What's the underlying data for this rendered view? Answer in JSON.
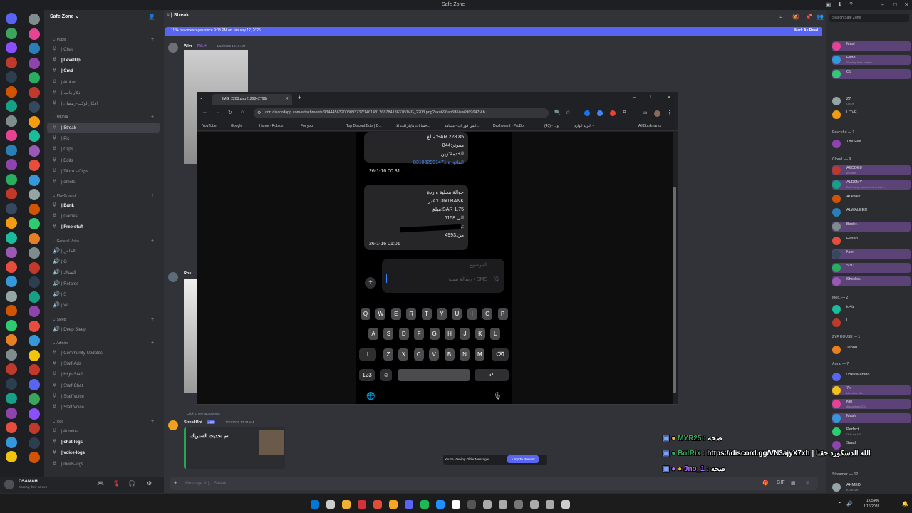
{
  "window": {
    "title": "Safe Zone"
  },
  "server": {
    "name": "Safe Zone",
    "categories": {
      "public": "Public",
      "media": "MEDIA",
      "playground": "PlayGround",
      "general_voice": "General Voice",
      "sleep": "Sleep",
      "admins": "Admins",
      "logs": "logs"
    },
    "public_channels": [
      "| Chat",
      "| LevelUp",
      "| Cmd",
      "| Athkar",
      "| اذكارجانت",
      "| افكار-لوكت-رمضان"
    ],
    "media_channels": [
      "| Streak",
      "| Pic",
      "| Clips",
      "| Edits",
      "| Tiktok - Clips",
      "| emots"
    ],
    "playground_channels": [
      "| Bank",
      "| Games",
      "| Free-stuff"
    ],
    "voice_channels": [
      "| الخاص",
      "| G",
      "| الستاك",
      "| Retards",
      "| S",
      "| W"
    ],
    "sleep_channels": [
      "| Deep Sleep"
    ],
    "admin_channels": [
      "| Community-Updates",
      "| Staff-Ads",
      "| High-Staff",
      "| Staff-Chat",
      "| Staff Voice",
      "| Staff Voice"
    ],
    "log_channels": [
      "| Admins",
      "| chat-logs",
      "| voice-logs",
      "| mods-logs"
    ]
  },
  "user": {
    "name": "OSAMAH",
    "status": "Sharing their screen"
  },
  "chat": {
    "channel": "| Streak",
    "new_messages_banner": "113+ new messages since 9:03 PM on January 12, 2026",
    "mark_as_read": "Mark As Read",
    "msg1_author": "Wlvr",
    "msg1_tag": "JWLH",
    "msg1_time": "1/10/2026 12:19 AM",
    "msg2_author": "Ros",
    "attachment_hint": "Click to see attachment",
    "bot_author": "StreakBot",
    "bot_tag": "APP",
    "bot_time": "1/10/2026 12:34 AM",
    "bot_embed_title": "تم تحديث الستريك",
    "viewing_older": "You're Viewing Older Messages",
    "jump_to_present": "Jump To Present",
    "input_placeholder": "Message #🌡| Streak"
  },
  "browser": {
    "tab_title": "IMG_2203.png (1290×2796)",
    "url": "cdn.discordapp.com/attachments/934445632008093737/1461481268784136376/IMG_2203.png?ex=696ab5ff&is=6969647f&h...",
    "bookmarks": [
      "YouTube",
      "Google",
      "Home - Roblox",
      "For you",
      "Top Discord Bots | D...",
      "حسابات مايكرافت الا...",
      "انمي فور اب - مشاهد...",
      "Dashboard - ProBot",
      "(43) - ...و",
      "البريد الوارد -",
      "All Bookmarks"
    ]
  },
  "sms": {
    "msg1_lines": [
      "مبلغ:SAR 228.85",
      "مفوتر:044",
      "الخدمة:زين",
      "الفاتورة:831032991471"
    ],
    "msg1_time": "26-1-16 00:31",
    "msg2_lines": [
      "حوالة محلية واردة",
      "عبر:D360 BANK",
      "مبلغ:SAR 1.75",
      "الى:6158",
      "من:",
      "من:4993"
    ],
    "msg2_time": "26-1-16 01:01",
    "subject_placeholder": "الموضوع",
    "text_placeholder": "رسالة نصية • SMS",
    "keys_row1": [
      "Q",
      "W",
      "E",
      "R",
      "T",
      "Y",
      "U",
      "I",
      "O",
      "P"
    ],
    "keys_row2": [
      "A",
      "S",
      "D",
      "F",
      "G",
      "H",
      "J",
      "K",
      "L"
    ],
    "keys_row3": [
      "Z",
      "X",
      "C",
      "V",
      "B",
      "N",
      "M"
    ],
    "num_key": "123"
  },
  "members": {
    "search_placeholder": "Search Safe Zone",
    "groups": [
      "Peaceful — 1",
      "Cloud. — 9",
      "Mod. — 2",
      "ZYF HOUSE — 1",
      "Aura. — 7",
      "Streamer. — 12"
    ],
    "list": [
      {
        "name": "Maxi",
        "status": ""
      },
      {
        "name": "Fade",
        "status": "Sharing their screen"
      },
      {
        "name": "OL",
        "status": ""
      },
      {
        "name": "Z7",
        "status": "OZOF"
      },
      {
        "name": "LOVE.",
        "status": ""
      },
      {
        "name": "TheSlee...",
        "status": ""
      },
      {
        "name": "A6ODE8",
        "status": "In voice"
      },
      {
        "name": "ALD9MY",
        "status": "Don't stop, success isn't that ..."
      },
      {
        "name": "ALeNeZi",
        "status": ""
      },
      {
        "name": "ALWALEED",
        "status": ""
      },
      {
        "name": "Bader.",
        "status": ""
      },
      {
        "name": "Hasan",
        "status": ""
      },
      {
        "name": "Nxe",
        "status": ""
      },
      {
        "name": "S3D",
        "status": ""
      },
      {
        "name": "Shodoo.",
        "status": ""
      },
      {
        "name": "iq4iz",
        "status": ""
      },
      {
        "name": "L",
        "status": ""
      },
      {
        "name": "Jehod",
        "status": ""
      },
      {
        "name": "!!BestMartino",
        "status": ""
      },
      {
        "name": "7x",
        "status": "Live kick s7x"
      },
      {
        "name": "Kel",
        "status": "discord.gg/KOU"
      },
      {
        "name": "Mash",
        "status": ""
      },
      {
        "name": "Perfect",
        "status": "OutLaw V2"
      },
      {
        "name": "Saad",
        "status": ""
      },
      {
        "name": "AHMED",
        "status": "KLOOVR"
      }
    ]
  },
  "overlay": {
    "line1_name": "MYR25 :",
    "line1_text": "صحه",
    "line2_name": "BotRix :",
    "line2_text": "https://discord.gg/VN3ajyX7xh | الله الدسكورد حقنا",
    "line3_name": "Jno_1 :",
    "line3_text": "صحه"
  },
  "taskbar": {
    "time": "1:05 AM",
    "date": "1/16/2026"
  },
  "colors": {
    "accent": "#5865f2",
    "overlay_name": "#3ba55d",
    "overlay_text": "#ffffff",
    "purple_name": "#b56cff",
    "gold": "#f0b232"
  }
}
